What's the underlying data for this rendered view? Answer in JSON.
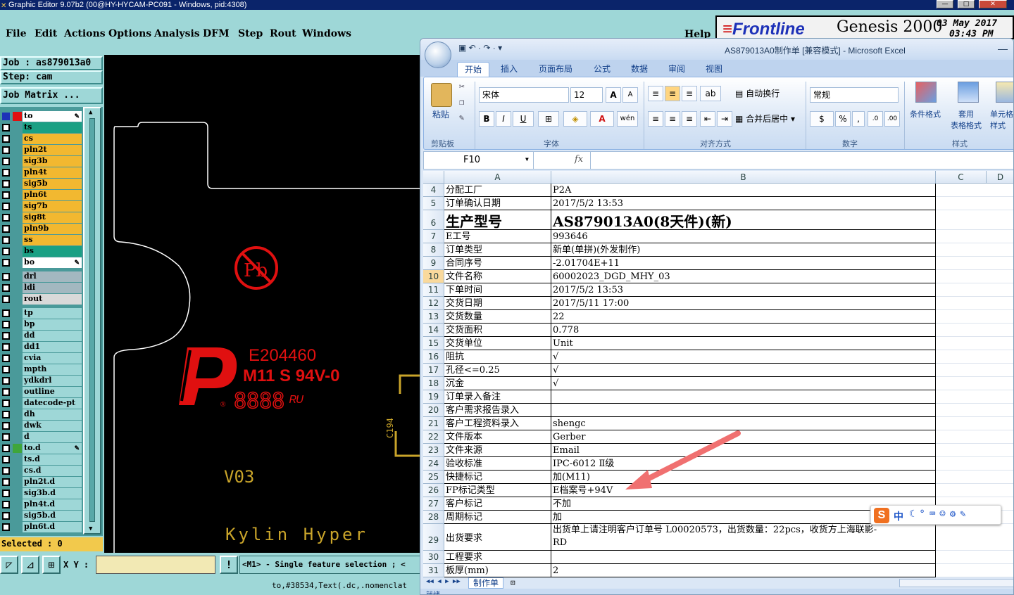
{
  "genesis": {
    "title": "Graphic Editor 9.07b2 (00@HY-HYCAM-PC091 - Windows, pid:4308)",
    "menu": [
      "File",
      "Edit",
      "Actions",
      "Options",
      "Analysis",
      "DFM",
      "Step",
      "Rout",
      "Windows"
    ],
    "help": "Help",
    "job_label": "Job : as879013a0",
    "step_label": "Step: cam",
    "job_matrix_button": "Job Matrix ...",
    "layers": [
      {
        "name": "to",
        "color": "#ffffff",
        "checked": true,
        "swatch": "#e01010"
      },
      {
        "name": "ts",
        "color": "#1aa084"
      },
      {
        "name": "cs",
        "color": "#f2b830"
      },
      {
        "name": "pln2t",
        "color": "#f2b830"
      },
      {
        "name": "sig3b",
        "color": "#f2b830"
      },
      {
        "name": "pln4t",
        "color": "#f2b830"
      },
      {
        "name": "sig5b",
        "color": "#f2b830"
      },
      {
        "name": "pln6t",
        "color": "#f2b830"
      },
      {
        "name": "sig7b",
        "color": "#f2b830"
      },
      {
        "name": "sig8t",
        "color": "#f2b830"
      },
      {
        "name": "pln9b",
        "color": "#f2b830"
      },
      {
        "name": "ss",
        "color": "#f2b830"
      },
      {
        "name": "bs",
        "color": "#1aa084"
      },
      {
        "name": "bo",
        "color": "#ffffff"
      },
      {
        "name": "drl",
        "color": "#a3b8c0"
      },
      {
        "name": "ldi",
        "color": "#a3b8c0"
      },
      {
        "name": "rout",
        "color": "#d9d9d9"
      },
      {
        "name": "tp",
        "color": "#9ed7d7"
      },
      {
        "name": "bp",
        "color": "#9ed7d7"
      },
      {
        "name": "dd",
        "color": "#9ed7d7"
      },
      {
        "name": "dd1",
        "color": "#9ed7d7"
      },
      {
        "name": "cvia",
        "color": "#9ed7d7"
      },
      {
        "name": "mpth",
        "color": "#9ed7d7"
      },
      {
        "name": "ydkdrl",
        "color": "#9ed7d7"
      },
      {
        "name": "outline",
        "color": "#9ed7d7"
      },
      {
        "name": "datecode-pt",
        "color": "#9ed7d7"
      },
      {
        "name": "dh",
        "color": "#9ed7d7"
      },
      {
        "name": "dwk",
        "color": "#9ed7d7"
      },
      {
        "name": "d",
        "color": "#9ed7d7"
      },
      {
        "name": "to.d",
        "color": "#9ed7d7",
        "swatch": "#3fa63a"
      },
      {
        "name": "ts.d",
        "color": "#9ed7d7"
      },
      {
        "name": "cs.d",
        "color": "#9ed7d7"
      },
      {
        "name": "pln2t.d",
        "color": "#9ed7d7"
      },
      {
        "name": "sig3b.d",
        "color": "#9ed7d7"
      },
      {
        "name": "pln4t.d",
        "color": "#9ed7d7"
      },
      {
        "name": "sig5b.d",
        "color": "#9ed7d7"
      },
      {
        "name": "pln6t.d",
        "color": "#9ed7d7"
      }
    ],
    "selected_status": "Selected : 0",
    "xy_label": "X Y :",
    "message": "<M1> - Single feature selection ; <",
    "footer": "to,#38534,Text(.dc,.nomenclat",
    "canvas": {
      "ul": "E204460",
      "spec": "M11 S 94V-0",
      "datecode": "8888",
      "ul_mark": "R",
      "version": "V03",
      "brand": "Kylin Hyper",
      "ref": "C194",
      "pb": "Pb"
    },
    "frontline": {
      "logo": "Frontline",
      "product": "Genesis 2000",
      "date": "03 May 2017",
      "time": "03:43 PM"
    }
  },
  "excel": {
    "title": "AS879013A0制作单  [兼容模式] - Microsoft Excel",
    "tabs": [
      "开始",
      "插入",
      "页面布局",
      "公式",
      "数据",
      "审阅",
      "视图"
    ],
    "ribbon": {
      "clipboard": "剪贴板",
      "paste": "粘贴",
      "font_group": "字体",
      "font_name": "宋体",
      "font_size": "12",
      "align_group": "对齐方式",
      "wrap": "自动换行",
      "merge": "合并后居中",
      "number_group": "数字",
      "number_format": "常规",
      "styles_group": "样式",
      "cond_format": "条件格式",
      "table_format": "套用\n表格格式",
      "cell_style": "单元格\n样式"
    },
    "name_box": "F10",
    "fx": "fx",
    "columns": [
      "A",
      "B",
      "C",
      "D"
    ],
    "rows": [
      {
        "n": "4",
        "a": "分配工厂",
        "b": "P2A"
      },
      {
        "n": "5",
        "a": "订单确认日期",
        "b": "2017/5/2 13:53"
      },
      {
        "n": "6",
        "a": "生产型号",
        "b": "AS879013A0(8天件)(新)",
        "big": true
      },
      {
        "n": "7",
        "a": "E工号",
        "b": "993646"
      },
      {
        "n": "8",
        "a": "订单类型",
        "b": "新单(单拼)(外发制作)"
      },
      {
        "n": "9",
        "a": "合同序号",
        "b": "-2.01704E+11"
      },
      {
        "n": "10",
        "a": "文件名称",
        "b": "60002023_DGD_MHY_03",
        "sel": true
      },
      {
        "n": "11",
        "a": "下单时间",
        "b": "2017/5/2 13:53"
      },
      {
        "n": "12",
        "a": "交货日期",
        "b": "2017/5/11 17:00"
      },
      {
        "n": "13",
        "a": "交货数量",
        "b": "22"
      },
      {
        "n": "14",
        "a": "交货面积",
        "b": "0.778"
      },
      {
        "n": "15",
        "a": "交货单位",
        "b": "Unit"
      },
      {
        "n": "16",
        "a": "阻抗",
        "b": "√"
      },
      {
        "n": "17",
        "a": "孔径<=0.25",
        "b": "√"
      },
      {
        "n": "18",
        "a": "沉金",
        "b": "√"
      },
      {
        "n": "19",
        "a": "订单录入备注",
        "b": ""
      },
      {
        "n": "20",
        "a": "客户需求报告录入",
        "b": ""
      },
      {
        "n": "21",
        "a": "客户工程资料录入",
        "b": "shengc"
      },
      {
        "n": "22",
        "a": "文件版本",
        "b": "Gerber"
      },
      {
        "n": "23",
        "a": "文件来源",
        "b": "Email"
      },
      {
        "n": "24",
        "a": "验收标准",
        "b": "IPC-6012 Ⅱ级"
      },
      {
        "n": "25",
        "a": "快捷标记",
        "b": "加(M11)"
      },
      {
        "n": "26",
        "a": "FP标记类型",
        "b": "E档案号+94V"
      },
      {
        "n": "27",
        "a": "客户标记",
        "b": "不加"
      },
      {
        "n": "28",
        "a": "周期标记",
        "b": "加"
      },
      {
        "n": "29",
        "a": "出货要求",
        "b": "出货单上请注明客户订单号 L00020573，出货数量：22pcs，收货方上海联影-",
        "b2": "RD"
      },
      {
        "n": "30",
        "a": "工程要求",
        "b": ""
      },
      {
        "n": "31",
        "a": "板厚(mm)",
        "b": "2"
      }
    ],
    "sheet_tab": "制作单",
    "status": "就绪"
  },
  "ime": {
    "logo": "S",
    "mode": "中"
  }
}
